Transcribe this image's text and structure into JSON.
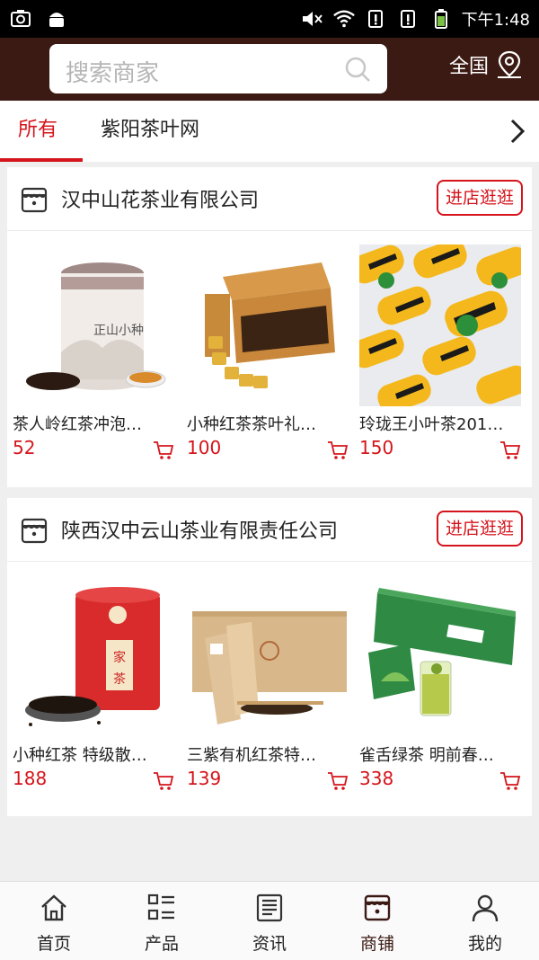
{
  "status_bar": {
    "time": "下午1:48"
  },
  "header": {
    "search_placeholder": "搜索商家",
    "region_label": "全国"
  },
  "tabs": [
    {
      "label": "所有",
      "active": true
    },
    {
      "label": "紫阳茶叶网",
      "active": false
    }
  ],
  "stores": [
    {
      "name": "汉中山花茶业有限公司",
      "visit_label": "进店逛逛",
      "products": [
        {
          "name": "茶人岭红茶冲泡…",
          "price": "52"
        },
        {
          "name": "小种红茶茶叶礼…",
          "price": "100"
        },
        {
          "name": "玲珑王小叶茶201…",
          "price": "150"
        }
      ]
    },
    {
      "name": "陕西汉中云山茶业有限责任公司",
      "visit_label": "进店逛逛",
      "products": [
        {
          "name": "小种红茶 特级散…",
          "price": "188"
        },
        {
          "name": "三紫有机红茶特…",
          "price": "139"
        },
        {
          "name": "雀舌绿茶 明前春…",
          "price": "338"
        }
      ]
    }
  ],
  "bottom_nav": [
    {
      "label": "首页",
      "icon": "home-icon"
    },
    {
      "label": "产品",
      "icon": "grid-list-icon"
    },
    {
      "label": "资讯",
      "icon": "news-icon"
    },
    {
      "label": "商铺",
      "icon": "shop-icon",
      "active": true
    },
    {
      "label": "我的",
      "icon": "user-icon"
    }
  ],
  "colors": {
    "accent": "#d5141b",
    "header_bg": "#3c1a14"
  }
}
